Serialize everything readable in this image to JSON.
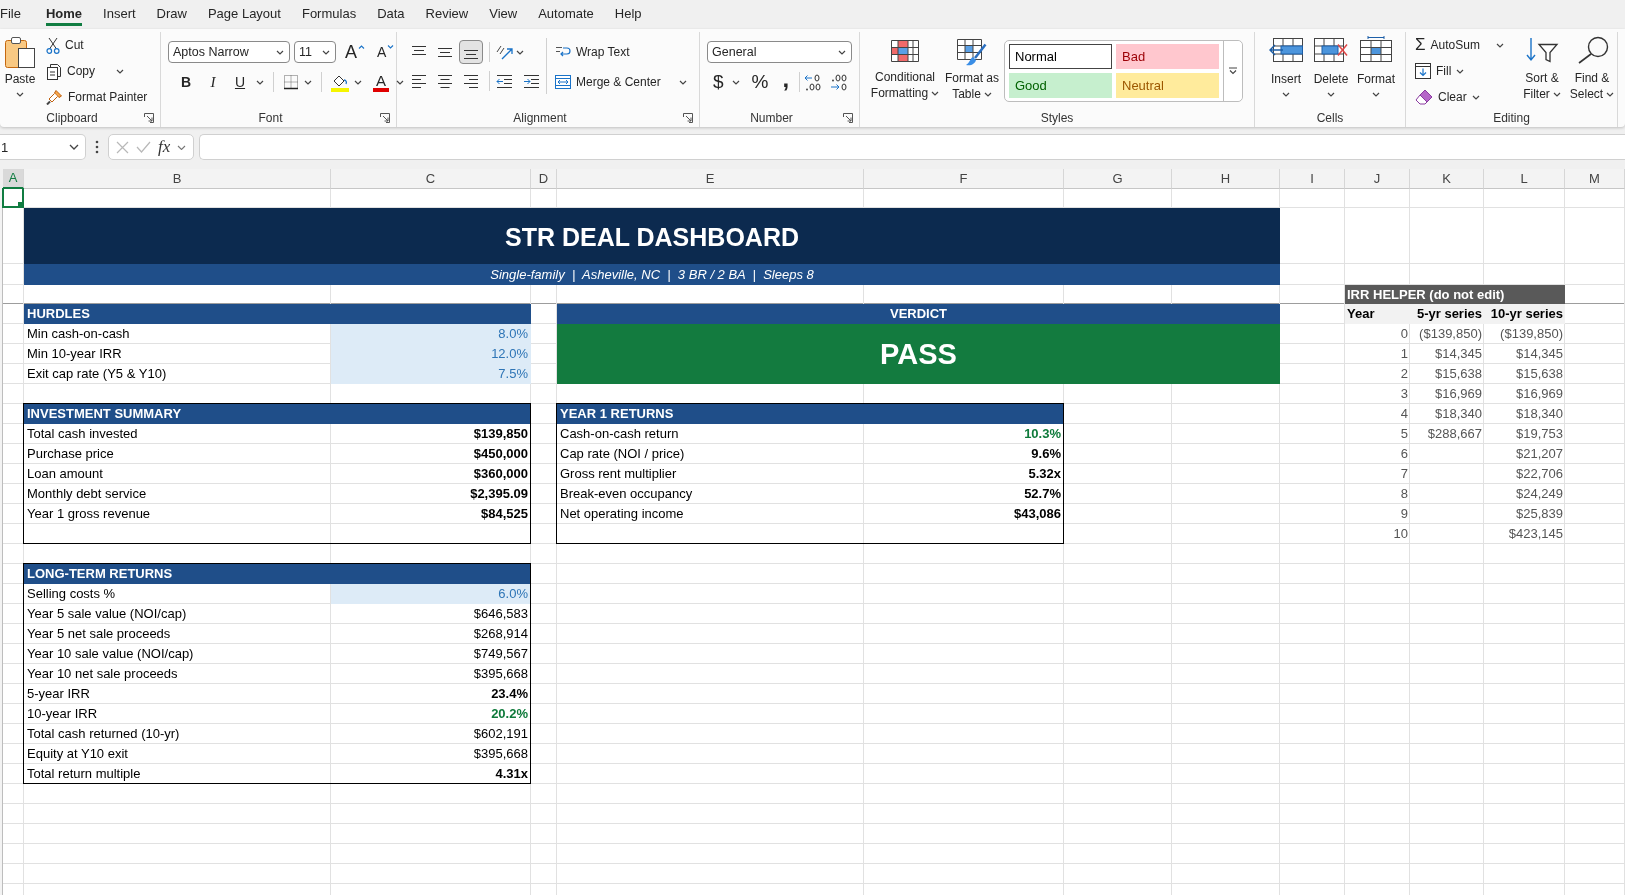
{
  "menu_tabs": [
    {
      "label": "File",
      "selected": false
    },
    {
      "label": "Home",
      "selected": true
    },
    {
      "label": "Insert",
      "selected": false
    },
    {
      "label": "Draw",
      "selected": false
    },
    {
      "label": "Page Layout",
      "selected": false
    },
    {
      "label": "Formulas",
      "selected": false
    },
    {
      "label": "Data",
      "selected": false
    },
    {
      "label": "Review",
      "selected": false
    },
    {
      "label": "View",
      "selected": false
    },
    {
      "label": "Automate",
      "selected": false
    },
    {
      "label": "Help",
      "selected": false
    }
  ],
  "ribbon": {
    "clipboard": {
      "label": "Clipboard",
      "paste": "Paste",
      "cut": "Cut",
      "copy": "Copy",
      "format_painter": "Format Painter"
    },
    "font": {
      "label": "Font",
      "font_name": "Aptos Narrow",
      "font_size": "11",
      "grow_font": "A",
      "shrink_font": "A",
      "bold": "B",
      "italic": "I",
      "underline": "U",
      "font_color": "A"
    },
    "alignment": {
      "label": "Alignment",
      "vertical": [
        {
          "kind": "top",
          "selected": false
        },
        {
          "kind": "middle",
          "selected": false
        },
        {
          "kind": "bottom",
          "selected": true
        }
      ],
      "wrap_text": "Wrap Text",
      "merge_center": "Merge & Center"
    },
    "number": {
      "label": "Number",
      "format": "General",
      "currency": "$",
      "percent": "%",
      "comma_style": ","
    },
    "styles": {
      "label": "Styles",
      "conditional_formatting": "Conditional Formatting",
      "format_as_table": "Format as Table",
      "gallery": [
        {
          "label": "Normal",
          "kind": "normal",
          "selected": true
        },
        {
          "label": "Bad",
          "kind": "bad",
          "selected": false
        },
        {
          "label": "Good",
          "kind": "good",
          "selected": false
        },
        {
          "label": "Neutral",
          "kind": "neutral",
          "selected": false
        }
      ]
    },
    "cells": {
      "label": "Cells",
      "insert": "Insert",
      "delete": "Delete",
      "format": "Format"
    },
    "editing": {
      "label": "Editing",
      "autosum_symbol": "Σ",
      "autosum": "AutoSum",
      "fill": "Fill",
      "clear": "Clear",
      "sort_filter": "Sort & Filter",
      "find_select": "Find & Select"
    }
  },
  "formula_bar": {
    "name_box": "1",
    "cancel": {
      "disabled": true
    },
    "enter": {
      "disabled": true
    },
    "function_label": "fx"
  },
  "column_headers": [
    {
      "label": "A",
      "selected": true
    },
    {
      "label": "B",
      "selected": false
    },
    {
      "label": "C",
      "selected": false
    },
    {
      "label": "D",
      "selected": false
    },
    {
      "label": "E",
      "selected": false
    },
    {
      "label": "F",
      "selected": false
    },
    {
      "label": "G",
      "selected": false
    },
    {
      "label": "H",
      "selected": false
    },
    {
      "label": "I",
      "selected": false
    },
    {
      "label": "J",
      "selected": false
    },
    {
      "label": "K",
      "selected": false
    },
    {
      "label": "L",
      "selected": false
    },
    {
      "label": "M",
      "selected": false
    }
  ],
  "sheet": {
    "title": "STR DEAL DASHBOARD",
    "subtitle": "Single-family  |  Asheville, NC  |  3 BR / 2 BA  |  Sleeps 8",
    "hurdles": {
      "title": "HURDLES",
      "framed": false,
      "rows": [
        {
          "label": "Min cash-on-cash",
          "value": "8.0%",
          "kind": "input"
        },
        {
          "label": "Min 10-year IRR",
          "value": "12.0%",
          "kind": "input"
        },
        {
          "label": "Exit cap rate (Y5 & Y10)",
          "value": "7.5%",
          "kind": "input"
        }
      ]
    },
    "verdict": {
      "title": "VERDICT",
      "result": "PASS",
      "kind": "pass"
    },
    "investment_summary": {
      "title": "INVESTMENT SUMMARY",
      "framed": true,
      "rows": [
        {
          "label": "Total cash invested",
          "value": "$139,850",
          "kind": "bold"
        },
        {
          "label": "Purchase price",
          "value": "$450,000",
          "kind": "bold"
        },
        {
          "label": "Loan amount",
          "value": "$360,000",
          "kind": "bold"
        },
        {
          "label": "Monthly debt service",
          "value": "$2,395.09",
          "kind": "bold"
        },
        {
          "label": "Year 1 gross revenue",
          "value": "$84,525",
          "kind": "bold"
        }
      ]
    },
    "year_1_returns": {
      "title": "YEAR 1 RETURNS",
      "framed": true,
      "rows": [
        {
          "label": "Cash-on-cash return",
          "value": "10.3%",
          "kind": "good"
        },
        {
          "label": "Cap rate (NOI / price)",
          "value": "9.6%",
          "kind": "bold"
        },
        {
          "label": "Gross rent multiplier",
          "value": "5.32x",
          "kind": "bold"
        },
        {
          "label": "Break-even occupancy",
          "value": "52.7%",
          "kind": "bold"
        },
        {
          "label": "Net operating income",
          "value": "$43,086",
          "kind": "bold"
        }
      ]
    },
    "long_term_returns": {
      "title": "LONG-TERM RETURNS",
      "framed": true,
      "rows": [
        {
          "label": "Selling costs %",
          "value": "6.0%",
          "kind": "input"
        },
        {
          "label": "Year 5 sale value (NOI/cap)",
          "value": "$646,583",
          "kind": "plain"
        },
        {
          "label": "Year 5 net sale proceeds",
          "value": "$268,914",
          "kind": "plain"
        },
        {
          "label": "Year 10 sale value (NOI/cap)",
          "value": "$749,567",
          "kind": "plain"
        },
        {
          "label": "Year 10 net sale proceeds",
          "value": "$395,668",
          "kind": "plain"
        },
        {
          "label": "5-year IRR",
          "value": "23.4%",
          "kind": "bold"
        },
        {
          "label": "10-year IRR",
          "value": "20.2%",
          "kind": "good"
        },
        {
          "label": "Total cash returned (10-yr)",
          "value": "$602,191",
          "kind": "plain"
        },
        {
          "label": "Equity at Y10 exit",
          "value": "$395,668",
          "kind": "plain"
        },
        {
          "label": "Total return multiple",
          "value": "4.31x",
          "kind": "bold"
        }
      ]
    },
    "irr_helper": {
      "title": "IRR HELPER (do not edit)",
      "columns": [
        "Year",
        "5-yr series",
        "10-yr series"
      ],
      "rows": [
        {
          "year": "0",
          "series_5yr": "($139,850)",
          "series_10yr": "($139,850)"
        },
        {
          "year": "1",
          "series_5yr": "$14,345",
          "series_10yr": "$14,345"
        },
        {
          "year": "2",
          "series_5yr": "$15,638",
          "series_10yr": "$15,638"
        },
        {
          "year": "3",
          "series_5yr": "$16,969",
          "series_10yr": "$16,969"
        },
        {
          "year": "4",
          "series_5yr": "$18,340",
          "series_10yr": "$18,340"
        },
        {
          "year": "5",
          "series_5yr": "$288,667",
          "series_10yr": "$19,753"
        },
        {
          "year": "6",
          "series_10yr": "$21,207"
        },
        {
          "year": "7",
          "series_10yr": "$22,706"
        },
        {
          "year": "8",
          "series_10yr": "$24,249"
        },
        {
          "year": "9",
          "series_10yr": "$25,839"
        },
        {
          "year": "10",
          "series_10yr": "$423,145"
        }
      ]
    }
  }
}
